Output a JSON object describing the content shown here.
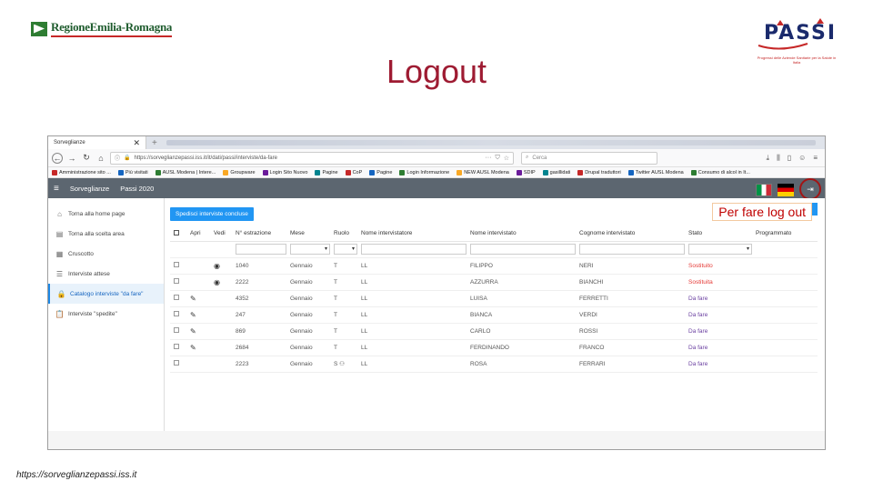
{
  "header": {
    "left_logo_text": "RegioneEmilia-Romagna",
    "title": "Logout",
    "passi_logo_text": "PASSI",
    "passi_subtitle": "Progressi delle Aziende Sanitarie per la Salute in Italia"
  },
  "footer": {
    "url": "https://sorveglianzepassi.iss.it"
  },
  "browser": {
    "tab_title": "Sorveglianze",
    "url": "https://sorveglianzepassi.iss.it/it/dati/passi/interviste/da-fare",
    "search_placeholder": "Cerca",
    "bookmarks": [
      "Amministrazione sito ...",
      "Più visitati",
      "AUSL Modena | Intere...",
      "Groupware",
      "Login Sito Nuovo",
      "Pagine",
      "CoP",
      "Pagine",
      "Login Informazione",
      "NEW AUSL Modena",
      "SDIP",
      "gasillidati",
      "Drupal traduttori",
      "Twitter AUSL Modena",
      "Consumo di alcol in It..."
    ]
  },
  "app": {
    "menu_label": "Sorveglianze",
    "section_label": "Passi 2020",
    "sidebar": [
      {
        "label": "Torna alla home page",
        "icon": "home-icon"
      },
      {
        "label": "Torna alla scelta area",
        "icon": "area-icon"
      },
      {
        "label": "Cruscotto",
        "icon": "dashboard-icon"
      },
      {
        "label": "Interviste attese",
        "icon": "list-icon"
      },
      {
        "label": "Catalogo interviste \"da fare\"",
        "icon": "lock-icon"
      },
      {
        "label": "Interviste \"spedite\"",
        "icon": "clipboard-icon"
      }
    ],
    "send_button": "Spedisci interviste concluse",
    "callout": "Per fare log out",
    "table": {
      "headers": [
        "",
        "Apri",
        "Vedi",
        "N° estrazione",
        "Mese",
        "Ruolo",
        "Nome intervistatore",
        "Nome intervistato",
        "Cognome intervistato",
        "Stato",
        "Programmato"
      ],
      "rows": [
        {
          "action": "eye",
          "n": "1040",
          "mese": "Gennaio",
          "ruolo": "T",
          "intervistatore": "LL",
          "nome": "FILIPPO",
          "cognome": "NERI",
          "stato": "Sostituito",
          "stato_color": "red"
        },
        {
          "action": "eye",
          "n": "2222",
          "mese": "Gennaio",
          "ruolo": "T",
          "intervistatore": "LL",
          "nome": "AZZURRA",
          "cognome": "BIANCHI",
          "stato": "Sostituita",
          "stato_color": "red"
        },
        {
          "action": "pencil",
          "n": "4352",
          "mese": "Gennaio",
          "ruolo": "T",
          "intervistatore": "LL",
          "nome": "LUISA",
          "cognome": "FERRETTI",
          "stato": "Da fare",
          "stato_color": "purple"
        },
        {
          "action": "pencil",
          "n": "247",
          "mese": "Gennaio",
          "ruolo": "T",
          "intervistatore": "LL",
          "nome": "BIANCA",
          "cognome": "VERDI",
          "stato": "Da fare",
          "stato_color": "purple"
        },
        {
          "action": "pencil",
          "n": "869",
          "mese": "Gennaio",
          "ruolo": "T",
          "intervistatore": "LL",
          "nome": "CARLO",
          "cognome": "ROSSI",
          "stato": "Da fare",
          "stato_color": "purple"
        },
        {
          "action": "pencil",
          "n": "2684",
          "mese": "Gennaio",
          "ruolo": "T",
          "intervistatore": "LL",
          "nome": "FERDINANDO",
          "cognome": "FRANCO",
          "stato": "Da fare",
          "stato_color": "purple"
        },
        {
          "action": "",
          "n": "2223",
          "mese": "Gennaio",
          "ruolo": "S",
          "intervistatore": "LL",
          "nome": "ROSA",
          "cognome": "FERRARI",
          "stato": "Da fare",
          "stato_color": "purple"
        }
      ]
    }
  }
}
